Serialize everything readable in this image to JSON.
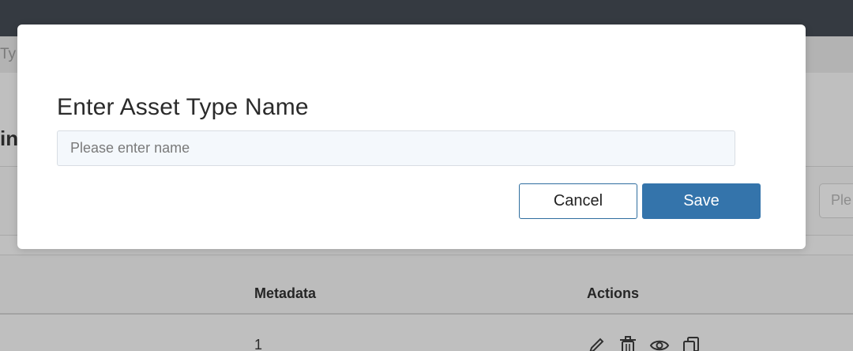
{
  "background": {
    "subbar_text": "Ty",
    "heading_fragment": "in",
    "search_placeholder_fragment": "Ple",
    "table": {
      "headers": [
        "Metadata",
        "Actions"
      ],
      "rows": [
        {
          "metadata": "1",
          "actions": [
            "edit-icon",
            "trash-icon",
            "eye-icon",
            "copy-icon"
          ]
        }
      ]
    }
  },
  "modal": {
    "title": "Enter Asset Type Name",
    "input": {
      "placeholder": "Please enter name",
      "value": ""
    },
    "cancel_label": "Cancel",
    "save_label": "Save"
  },
  "colors": {
    "topbar": "#353a41",
    "overlay": "#bdbdbd",
    "primary": "#3474ab",
    "input_bg": "#f4f8fc"
  }
}
